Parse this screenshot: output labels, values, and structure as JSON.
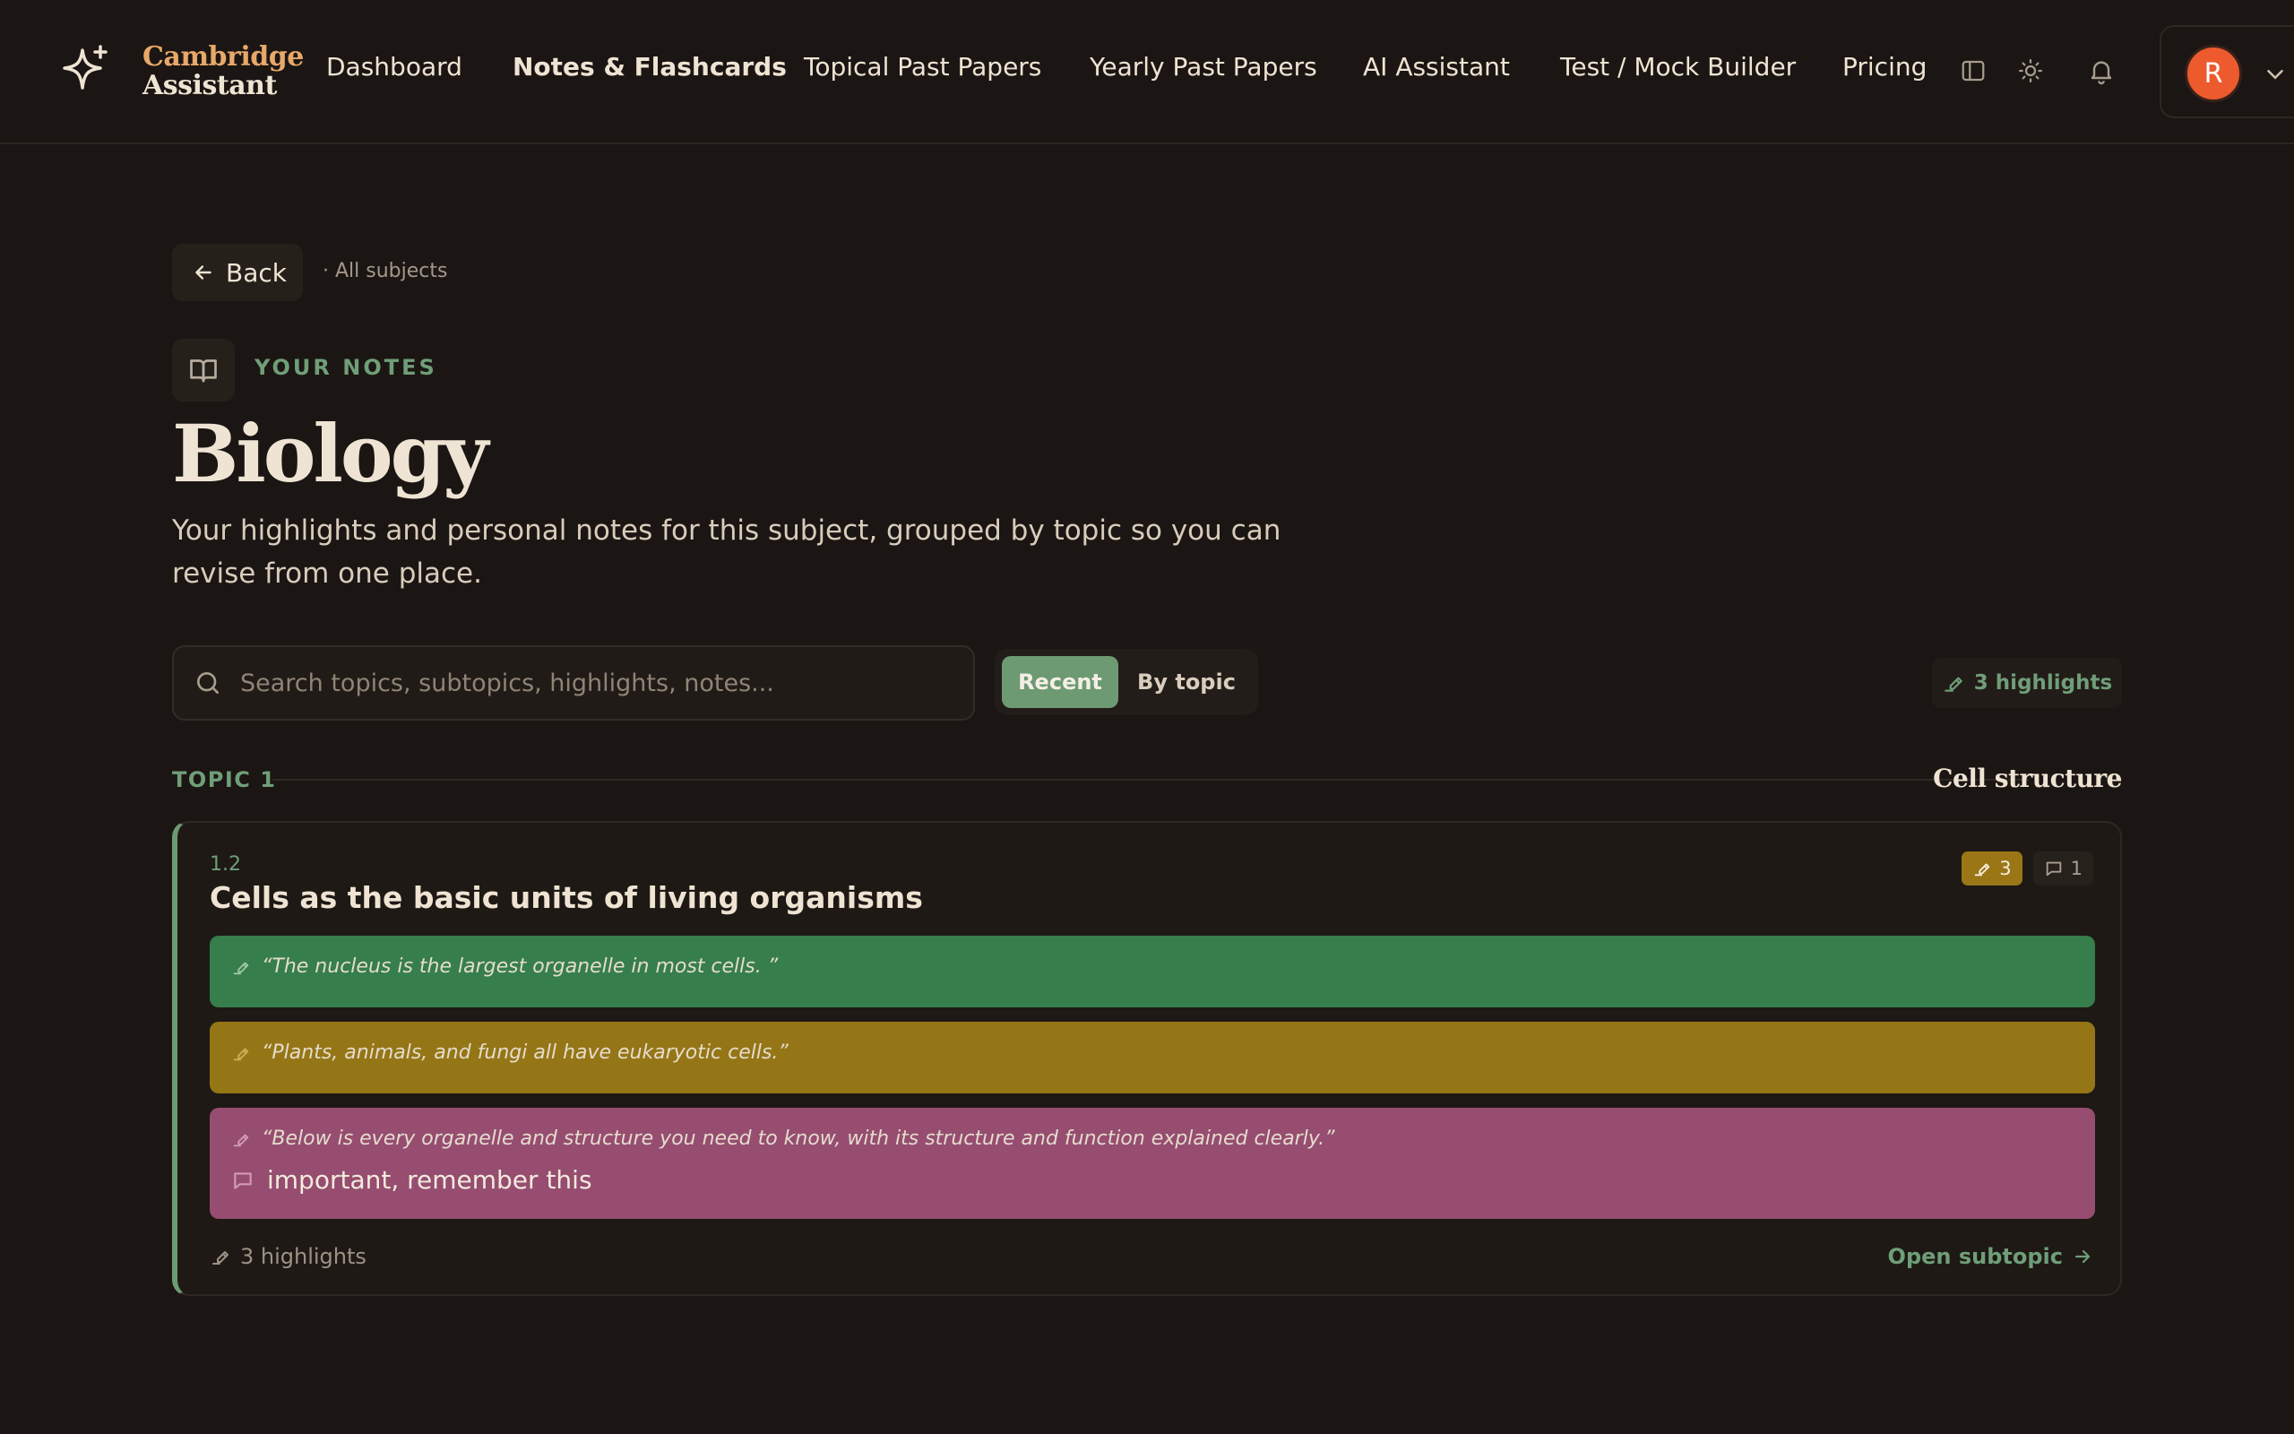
{
  "brand": {
    "line1": "Cambridge",
    "line2": "Assistant"
  },
  "nav": {
    "items": [
      {
        "label": "Dashboard"
      },
      {
        "label": "Notes & Flashcards"
      },
      {
        "label": "Topical Past Papers"
      },
      {
        "label": "Yearly Past Papers"
      },
      {
        "label": "AI Assistant"
      },
      {
        "label": "Test / Mock Builder"
      },
      {
        "label": "Pricing"
      }
    ],
    "active": "Notes & Flashcards"
  },
  "header_icons": [
    "sidebar-toggle-icon",
    "sun-icon",
    "bell-icon"
  ],
  "account": {
    "avatar_initial": "R",
    "avatar_color": "#ec5a2e"
  },
  "breadcrumb": {
    "back_label": "Back",
    "trail": "· All subjects"
  },
  "page": {
    "eyebrow": "YOUR NOTES",
    "title": "Biology",
    "description": "Your highlights and personal notes for this subject, grouped by topic so you can revise from one place."
  },
  "search": {
    "placeholder": "Search topics, subtopics, highlights, notes..."
  },
  "view_toggle": {
    "options": [
      "Recent",
      "By topic"
    ],
    "selected": "Recent"
  },
  "highlights_total": "3 highlights",
  "topics": [
    {
      "label": "TOPIC 1",
      "name": "Cell structure",
      "subtopics": [
        {
          "number": "1.2",
          "title": "Cells as the basic units of living organisms",
          "highlight_badge": "3",
          "comment_badge": "1",
          "highlights": [
            {
              "text": "“The nucleus is the largest organelle in most cells. ”",
              "color": "#367e4b"
            },
            {
              "text": "“Plants, animals, and fungi all have eukaryotic cells.”",
              "color": "#957616"
            },
            {
              "text": "“Below is every organelle and structure you need to know, with its structure and function explained clearly.”",
              "color": "#964d70",
              "note": "important, remember this"
            }
          ],
          "footer_count": "3 highlights",
          "open_label": "Open subtopic"
        }
      ]
    }
  ],
  "colors": {
    "accent_green": "#6d9a72",
    "brand_orange": "#e8a86a",
    "background": "#1b1613"
  }
}
